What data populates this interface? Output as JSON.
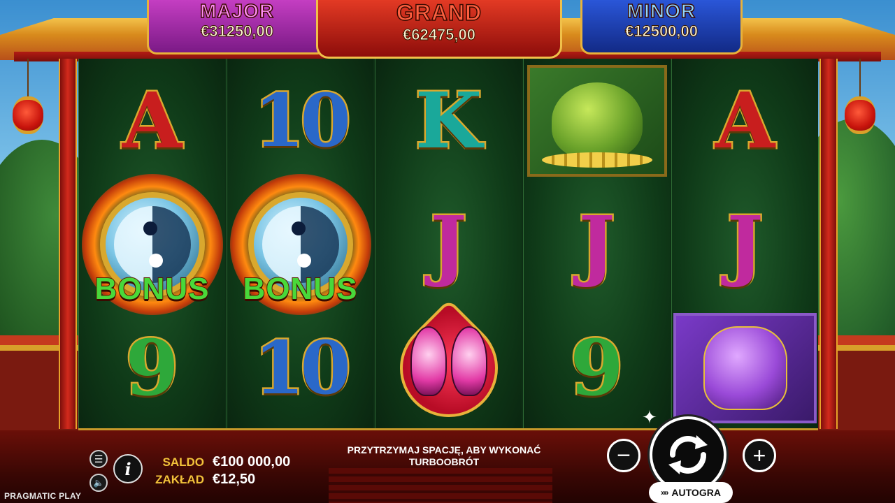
{
  "jackpots": {
    "major": {
      "title": "MAJOR",
      "value": "€31250,00"
    },
    "grand": {
      "title": "GRAND",
      "value": "€62475,00"
    },
    "minor": {
      "title": "MINOR",
      "value": "€12500,00"
    }
  },
  "reels": [
    [
      "A",
      "BONUS",
      "9"
    ],
    [
      "10",
      "BONUS",
      "10"
    ],
    [
      "K",
      "J",
      "butterfly-heart"
    ],
    [
      "golden-toad",
      "J",
      "9"
    ],
    [
      "A",
      "J",
      "fu-dog"
    ]
  ],
  "bonus_label": "BONUS",
  "controls": {
    "saldo_label": "SALDO",
    "saldo_value": "€100 000,00",
    "zaklad_label": "ZAKŁAD",
    "zaklad_value": "€12,50",
    "hint_text": "PRZYTRZYMAJ SPACJĘ, ABY WYKONAĆ TURBOOBRÓT",
    "minus_symbol": "−",
    "plus_symbol": "+",
    "autoplay_label": "AUTOGRA",
    "info_symbol": "i",
    "menu_symbol": "☰",
    "sound_symbol": "🔈",
    "spark_symbol": "✦",
    "chevrons": "»»"
  },
  "brand": "PRAGMATIC PLAY",
  "colors": {
    "gold": "#d9a82e",
    "label_yellow": "#f2c23a",
    "major_purple": "#7b1a86",
    "grand_red": "#8d0d0a",
    "minor_blue": "#122a86",
    "reel_green": "#0f3a18"
  }
}
